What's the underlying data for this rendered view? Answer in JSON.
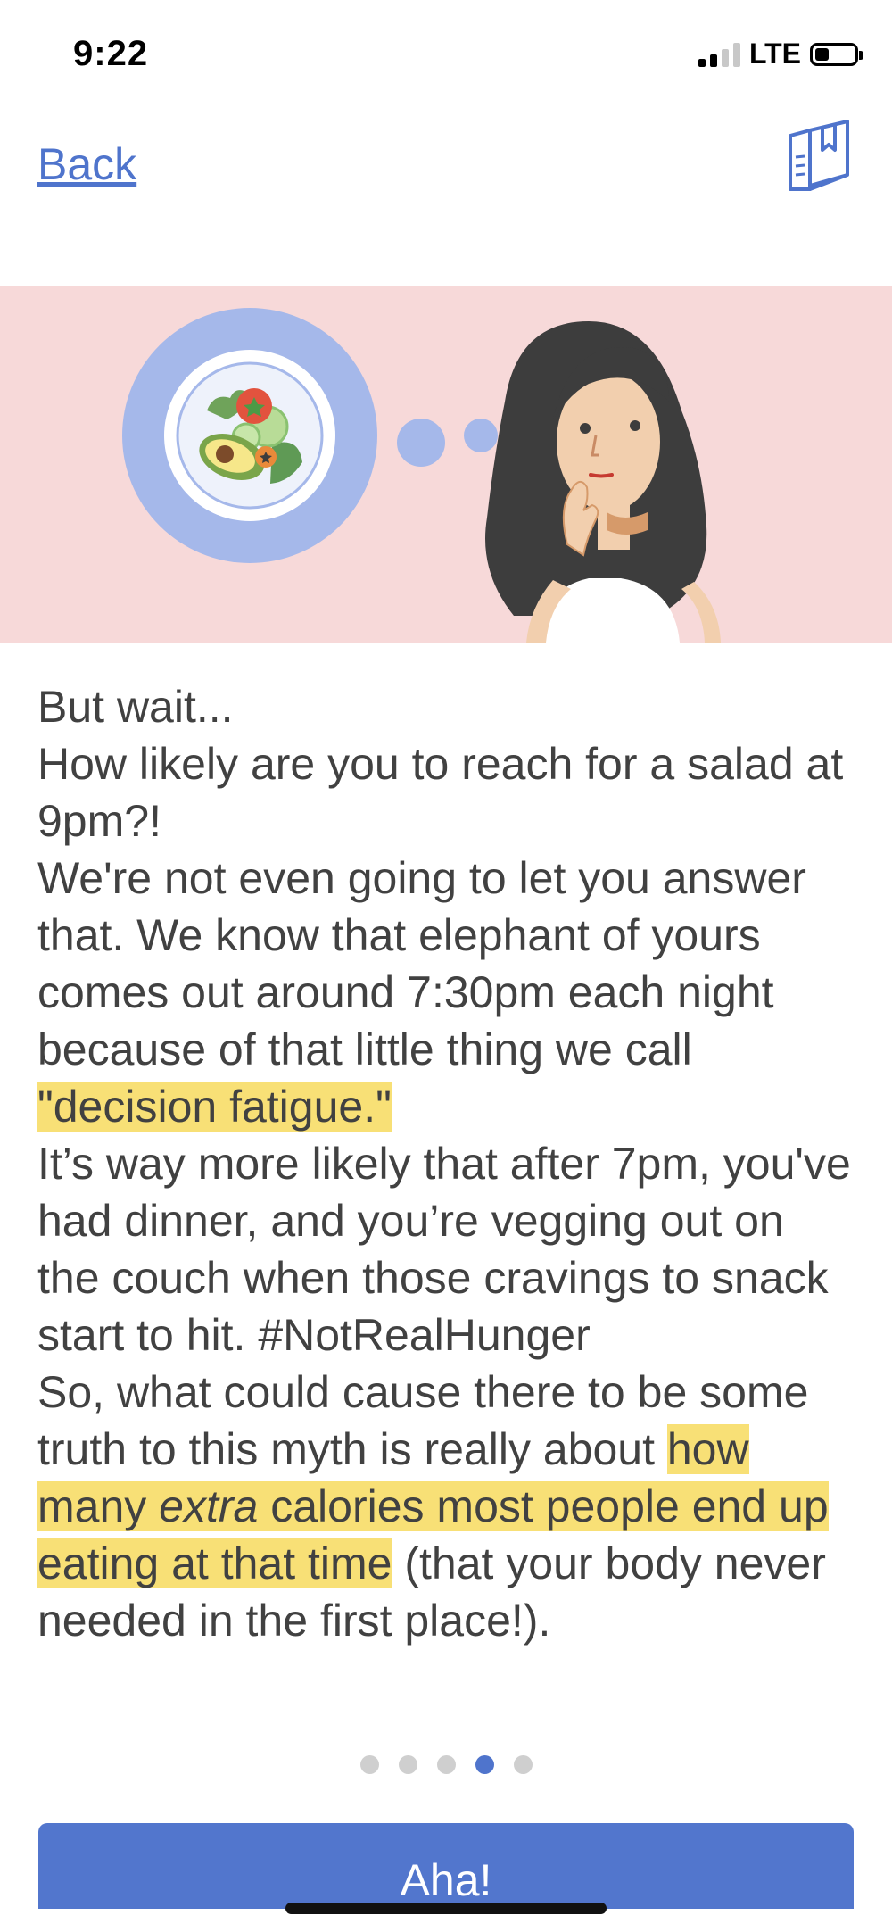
{
  "status_bar": {
    "time": "9:22",
    "network": "LTE",
    "signal_bars_active": 2,
    "battery_level": 0.35
  },
  "nav": {
    "back_label": "Back",
    "bookmark_icon": "bookmark-book-icon"
  },
  "hero": {
    "illustration": "woman-thinking-about-salad",
    "background_color": "#f7d9d9",
    "plate_color": "#a5b8ea"
  },
  "content": {
    "p1": "But wait...",
    "p2": "How likely are you to reach for a salad at 9pm?!",
    "p3_before": "We're not even going to let you answer that. We know that elephant of yours comes out around 7:30pm each night because of that little thing we call ",
    "p3_highlight": "\"decision fatigue.\"",
    "p4": "It’s way more likely that after 7pm, you've had dinner, and you’re vegging out on the couch when those cravings to snack start to hit. #NotRealHunger",
    "p5_before": "So, what could cause there to be some truth to this myth is really about ",
    "p5_hl_1": "how many ",
    "p5_hl_em": "extra",
    "p5_hl_2": " calories most people end up eating at that time",
    "p5_after": " (that your body never needed in the first place!)."
  },
  "pagination": {
    "total": 5,
    "current": 4
  },
  "cta": {
    "label": "Aha!"
  },
  "colors": {
    "accent": "#5276cd",
    "highlight": "#f8e076",
    "link": "#4f74cc"
  }
}
